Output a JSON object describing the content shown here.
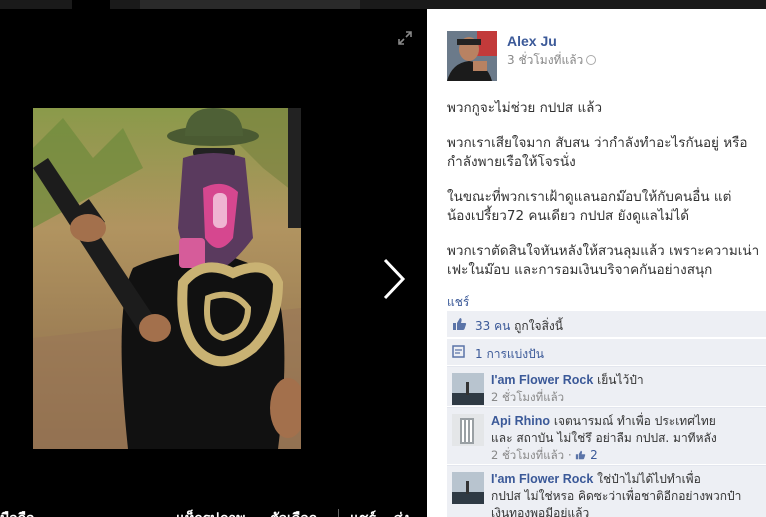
{
  "stage": {
    "bottom_left": "มือถือ",
    "tag_photo": "แท็กรูปภาพ",
    "options": "ตัวเลือก",
    "share": "แชร์",
    "send": "ส่ง"
  },
  "post": {
    "author": "Alex Ju",
    "time": "3 ชั่วโมงที่แล้ว",
    "paragraphs": [
      "พวกกูจะไม่ช่วย กปปส แล้ว",
      "พวกเราเสียใจมาก สับสน ว่ากำลังทำอะไรกันอยู่ หรือ",
      "กำลังพายเรือให้โจรนั่ง",
      "ในขณะที่พวกเราเฝ้าดูแลนอกม๊อบให้กับคนอื่น แต่",
      "น้องเปรี้ยว72 คนเดียว กปปส ยังดูแลไม่ได้",
      "พวกเราตัดสินใจหันหลังให้สวนลุมแล้ว เพราะความเน่า",
      "เฟะในม๊อบ และการอมเงินบริจาคกันอย่างสนุก"
    ],
    "share_link": "แชร์"
  },
  "engagement": {
    "likes_count": "33 คน",
    "likes_suffix": "ถูกใจสิ่งนี้",
    "shares": "1 การแบ่งปัน"
  },
  "comments": [
    {
      "name": "I'am Flower Rock",
      "text": "เย็นไว้ป๋า",
      "time": "2 ชั่วโมงที่แล้ว"
    },
    {
      "name": "Api Rhino",
      "text_line1": "เจตนารมณ์ ทำเพื่อ ประเทศไทย",
      "text_line2": "และ สถาบัน ไม่ใช่รึ อย่าลืม กปปส. มาทีหลัง",
      "time": "2 ชั่วโมงที่แล้ว",
      "likes": "2"
    },
    {
      "name": "I'am Flower Rock",
      "text_line1": "ใช่ป๋าไม่ได้ไปทำเพื่อ",
      "text_line2": "กปปส ไม่ใช่หรอ คิดซะว่าเพื่อชาติอีกอย่างพวกป๋า",
      "text_line3": "เงินทองพอมีอยู่แล้ว"
    }
  ],
  "colors": {
    "link": "#3b5998",
    "panel_bg": "#ffffff",
    "engagement_bg": "#edeff4"
  },
  "icons": [
    "expand-icon",
    "next-arrow-icon",
    "globe-icon",
    "like-icon",
    "share-icon"
  ]
}
